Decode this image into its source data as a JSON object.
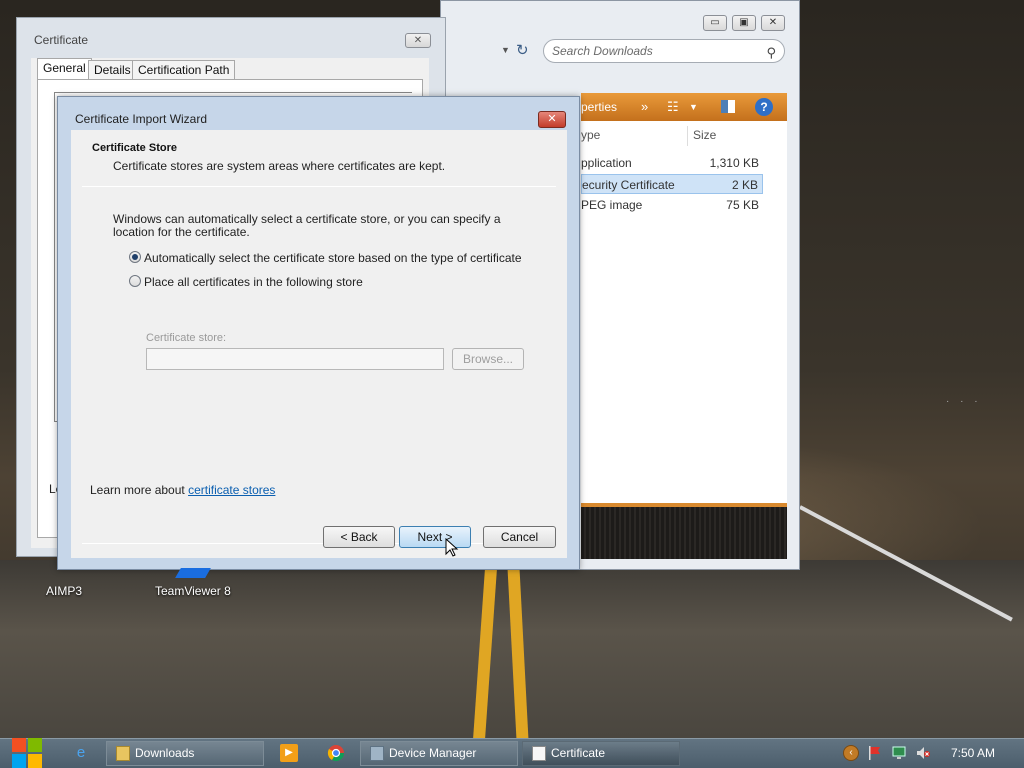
{
  "explorer": {
    "search_placeholder": "Search Downloads",
    "toolbar": {
      "properties_label": "perties",
      "more_glyph": "»"
    },
    "columns": {
      "type": "ype",
      "size": "Size"
    },
    "files": [
      {
        "type": "pplication",
        "size": "1,310 KB",
        "selected": false
      },
      {
        "type": "ecurity Certificate",
        "size": "2 KB",
        "selected": true
      },
      {
        "type": "PEG image",
        "size": "75 KB",
        "selected": false
      }
    ],
    "caption_glyphs": {
      "minimize": "▭",
      "maximize": "▣",
      "close": "✕"
    }
  },
  "cert_dialog": {
    "title": "Certificate",
    "tabs": [
      "General",
      "Details",
      "Certification Path"
    ],
    "active_tab": "General",
    "partial_text": "Le"
  },
  "wizard": {
    "title": "Certificate Import Wizard",
    "heading": "Certificate Store",
    "subheading": "Certificate stores are system areas where certificates are kept.",
    "intro": "Windows can automatically select a certificate store, or you can specify a location for the certificate.",
    "radio_auto": "Automatically select the certificate store based on the type of certificate",
    "radio_manual": "Place all certificates in the following store",
    "selected_option": "auto",
    "store_label": "Certificate store:",
    "store_value": "",
    "browse_label": "Browse...",
    "learn_more_text": "Learn more about ",
    "learn_more_link": "certificate stores",
    "back_label": "< Back",
    "next_label": "Next >",
    "cancel_label": "Cancel",
    "close_glyph": "✕"
  },
  "desktop": {
    "icons": [
      {
        "label": "AIMP3"
      },
      {
        "label": "TeamViewer 8"
      }
    ]
  },
  "taskbar": {
    "items": [
      {
        "label": "Downloads",
        "icon": "folder-icon"
      },
      {
        "label": "Device Manager",
        "icon": "device-manager-icon"
      },
      {
        "label": "Certificate",
        "icon": "certificate-icon",
        "active": true
      }
    ],
    "pinned": [
      "internet-explorer-icon",
      "media-player-icon",
      "chrome-icon"
    ],
    "tray": [
      "back-arrow-icon",
      "flag-icon",
      "network-icon",
      "volume-muted-icon"
    ],
    "clock": "7:50 AM"
  },
  "colors": {
    "accent_orange": "#d98a2f",
    "wizard_frame": "#c6d6e9",
    "link": "#0b5fb0",
    "close_red": "#c33c2a"
  }
}
